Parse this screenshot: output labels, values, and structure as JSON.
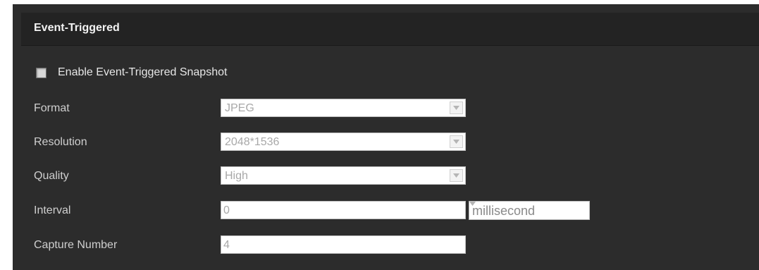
{
  "section": {
    "title": "Event-Triggered"
  },
  "enable": {
    "label": "Enable Event-Triggered Snapshot",
    "checked": false
  },
  "format": {
    "label": "Format",
    "value": "JPEG"
  },
  "resolution": {
    "label": "Resolution",
    "value": "2048*1536"
  },
  "quality": {
    "label": "Quality",
    "value": "High"
  },
  "interval": {
    "label": "Interval",
    "value": "0",
    "unit": "millisecond"
  },
  "capture": {
    "label": "Capture Number",
    "value": "4"
  },
  "icons": {
    "dropdown": "chevron-down-icon"
  }
}
